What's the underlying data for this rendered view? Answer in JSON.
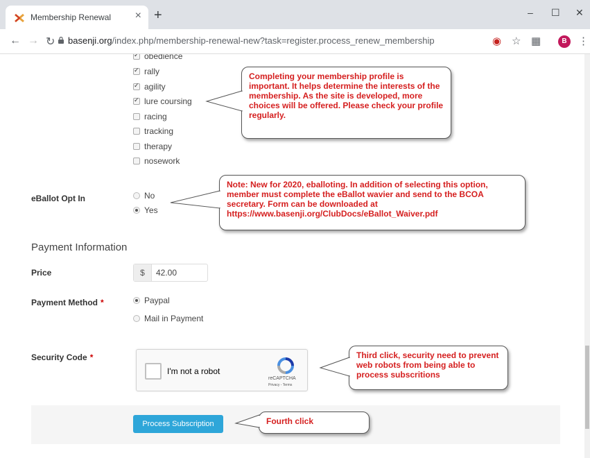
{
  "browser": {
    "tab_title": "Membership Renewal",
    "tab_close": "×",
    "new_tab": "+",
    "url_host": "basenji.org",
    "url_path": "/index.php/membership-renewal-new?task=register.process_renew_membership",
    "avatar_initial": "B",
    "minimize": "–",
    "maximize": "☐",
    "close": "✕"
  },
  "interests": [
    {
      "label": "obedience",
      "checked": true
    },
    {
      "label": "rally",
      "checked": true
    },
    {
      "label": "agility",
      "checked": true
    },
    {
      "label": "lure coursing",
      "checked": true
    },
    {
      "label": "racing",
      "checked": false
    },
    {
      "label": "tracking",
      "checked": false
    },
    {
      "label": "therapy",
      "checked": false
    },
    {
      "label": "nosework",
      "checked": false
    }
  ],
  "eballot": {
    "label": "eBallot Opt In",
    "options": [
      {
        "label": "No",
        "selected": false
      },
      {
        "label": "Yes",
        "selected": true
      }
    ]
  },
  "payment": {
    "section_title": "Payment Information",
    "price_label": "Price",
    "currency": "$",
    "price_value": "42.00",
    "method_label": "Payment Method",
    "required_mark": "*",
    "methods": [
      {
        "label": "Paypal",
        "selected": true
      },
      {
        "label": "Mail in Payment",
        "selected": false
      }
    ]
  },
  "security": {
    "label": "Security Code",
    "required_mark": "*",
    "recaptcha_text": "I'm not a robot",
    "recaptcha_brand": "reCAPTCHA",
    "recaptcha_links": "Privacy - Terms"
  },
  "submit": {
    "label": "Process Subscription"
  },
  "callouts": {
    "profile": "Completing your membership profile is important.  It helps determine the interests of the membership.  As the site is developed, more choices will be offered.  Please check your profile regularly.",
    "eballot": "Note: New for 2020, eballoting.  In addition of selecting this option, member must complete the eBallot wavier and send to the BCOA secretary.  Form can be downloaded at https://www.basenji.org/ClubDocs/eBallot_Waiver.pdf",
    "security": "Third click, security need to prevent web robots from being able to process subscritions",
    "submit": "Fourth click"
  },
  "colors": {
    "callout_text": "#d51f1f",
    "button": "#2ea6d9"
  }
}
